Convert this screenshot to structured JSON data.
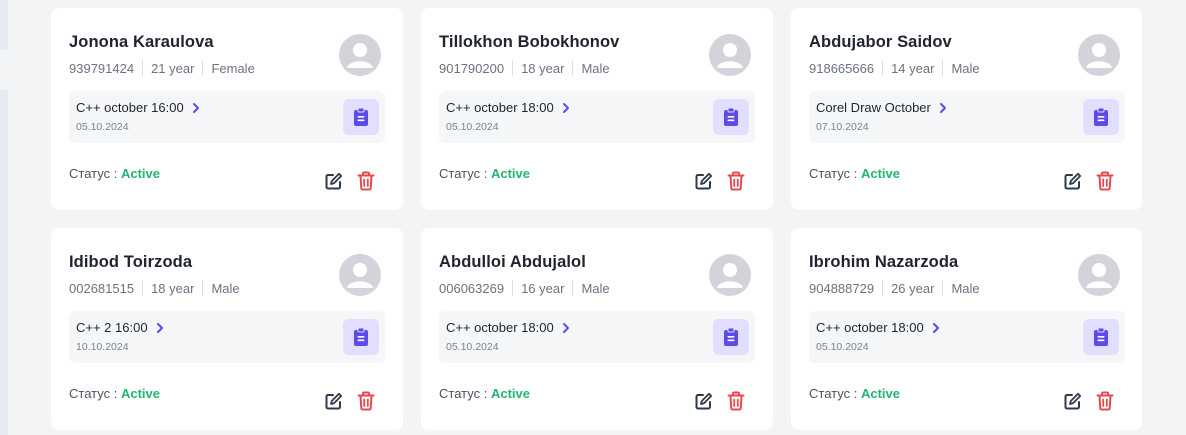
{
  "status_label": "Статус :",
  "colors": {
    "accent": "#5b4ce8",
    "active": "#22b573",
    "delete": "#e5484d"
  },
  "students": [
    {
      "name": "Jonona Karaulova",
      "phone": "939791424",
      "age": "21 year",
      "gender": "Female",
      "course": "C++ october 16:00",
      "date": "05.10.2024",
      "status": "Active"
    },
    {
      "name": "Tillokhon Bobokhonov",
      "phone": "901790200",
      "age": "18 year",
      "gender": "Male",
      "course": "C++ october 18:00",
      "date": "05.10.2024",
      "status": "Active"
    },
    {
      "name": "Abdujabor Saidov",
      "phone": "918665666",
      "age": "14 year",
      "gender": "Male",
      "course": "Corel Draw October",
      "date": "07.10.2024",
      "status": "Active"
    },
    {
      "name": "Idibod Toirzoda",
      "phone": "002681515",
      "age": "18 year",
      "gender": "Male",
      "course": "C++ 2 16:00",
      "date": "10.10.2024",
      "status": "Active"
    },
    {
      "name": "Abdulloi Abdujalol",
      "phone": "006063269",
      "age": "16 year",
      "gender": "Male",
      "course": "C++ october 18:00",
      "date": "05.10.2024",
      "status": "Active"
    },
    {
      "name": "Ibrohim Nazarzoda",
      "phone": "904888729",
      "age": "26 year",
      "gender": "Male",
      "course": "C++ october 18:00",
      "date": "05.10.2024",
      "status": "Active"
    }
  ],
  "icons": {
    "avatar": "user-avatar-icon",
    "course_link": "chevron-right-icon",
    "clipboard": "clipboard-icon",
    "edit": "edit-icon",
    "delete": "trash-icon"
  }
}
